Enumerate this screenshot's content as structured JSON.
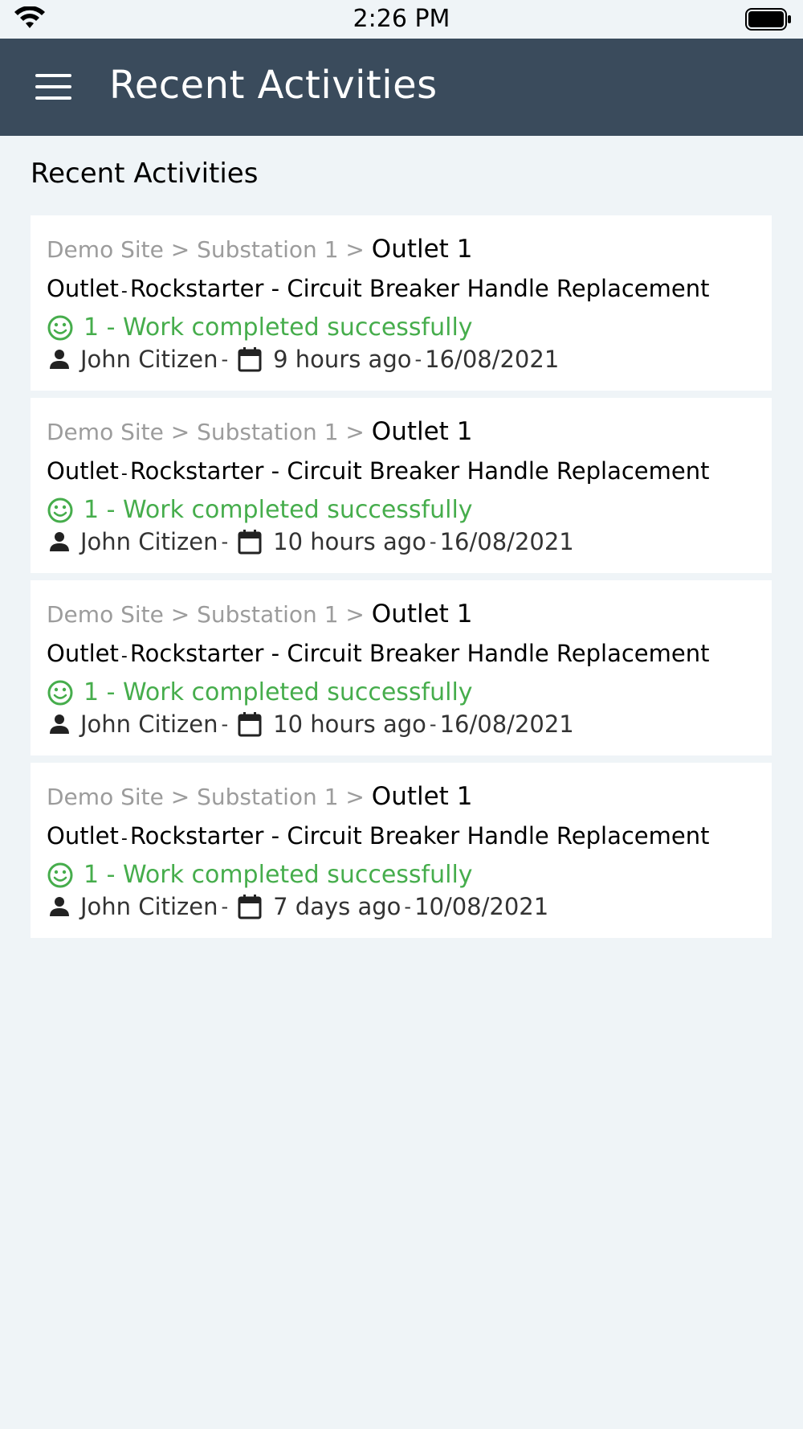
{
  "status_bar": {
    "time": "2:26 PM",
    "wifi_icon": "wifi-icon",
    "battery_icon": "battery-icon"
  },
  "header": {
    "menu_icon": "hamburger-menu-icon",
    "title": "Recent Activities"
  },
  "section": {
    "title": "Recent Activities"
  },
  "activities": [
    {
      "breadcrumb": {
        "site": "Demo Site",
        "separator": ">",
        "substation": "Substation 1",
        "outlet": "Outlet 1"
      },
      "title_prefix": "Outlet",
      "title_sep": "-",
      "title_main": "Rockstarter - Circuit Breaker Handle Replacement",
      "status": "1 - Work completed successfully",
      "user": "John Citizen",
      "meta_sep": "-",
      "relative_time": "9 hours ago",
      "date": "16/08/2021"
    },
    {
      "breadcrumb": {
        "site": "Demo Site",
        "separator": ">",
        "substation": "Substation 1",
        "outlet": "Outlet 1"
      },
      "title_prefix": "Outlet",
      "title_sep": "-",
      "title_main": "Rockstarter - Circuit Breaker Handle Replacement",
      "status": "1 - Work completed successfully",
      "user": "John Citizen",
      "meta_sep": "-",
      "relative_time": "10 hours ago",
      "date": "16/08/2021"
    },
    {
      "breadcrumb": {
        "site": "Demo Site",
        "separator": ">",
        "substation": "Substation 1",
        "outlet": "Outlet 1"
      },
      "title_prefix": "Outlet",
      "title_sep": "-",
      "title_main": "Rockstarter - Circuit Breaker Handle Replacement",
      "status": "1 - Work completed successfully",
      "user": "John Citizen",
      "meta_sep": "-",
      "relative_time": "10 hours ago",
      "date": "16/08/2021"
    },
    {
      "breadcrumb": {
        "site": "Demo Site",
        "separator": ">",
        "substation": "Substation 1",
        "outlet": "Outlet 1"
      },
      "title_prefix": "Outlet",
      "title_sep": "-",
      "title_main": "Rockstarter - Circuit Breaker Handle Replacement",
      "status": "1 - Work completed successfully",
      "user": "John Citizen",
      "meta_sep": "-",
      "relative_time": "7 days ago",
      "date": "10/08/2021"
    }
  ],
  "colors": {
    "header_bg": "#3a4b5c",
    "page_bg": "#eff4f7",
    "success": "#46ad4c",
    "muted": "#9c9c9c"
  }
}
